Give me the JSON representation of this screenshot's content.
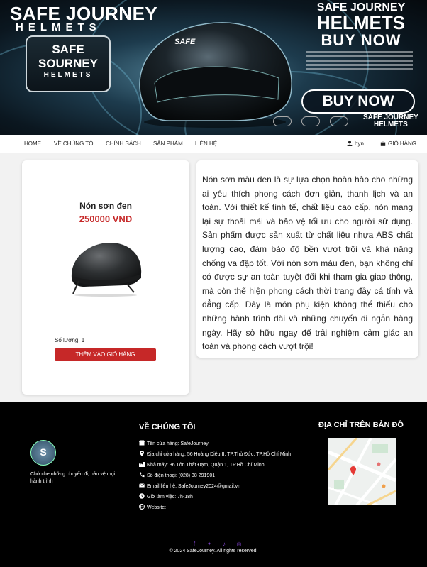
{
  "banner": {
    "brand_title": "SAFE JOURNEY",
    "brand_sub": "HELMETS",
    "shield_line1": "SAFE",
    "shield_line2": "SOURNEY",
    "shield_line3": "HELMETS",
    "right_line1": "SAFE JOURNEY",
    "right_line2": "HELMETS",
    "right_line3": "BUY NOW",
    "buy_now": "BUY NOW",
    "mini_brand_line1": "SAFE JOURNEY",
    "mini_brand_line2": "HELMETS",
    "helmet_logo": "SAFE"
  },
  "nav": {
    "items": [
      "HOME",
      "VỀ CHÚNG TÔI",
      "CHÍNH SÁCH",
      "SẢN PHẨM",
      "LIÊN HỆ"
    ],
    "user": "hyn",
    "cart": "GIỎ HÀNG"
  },
  "product": {
    "name": "Nón sơn đen",
    "price": "250000 VND",
    "quantity": "Số lượng: 1",
    "add_to_cart": "THÊM VÀO GIỎ HÀNG",
    "description": "Nón sơn màu đen là sự lựa chọn hoàn hảo cho những ai yêu thích phong cách đơn giản, thanh lịch và an toàn. Với thiết kế tinh tế, chất liệu cao cấp, nón mang lại sự thoải mái và bảo vệ tối ưu cho người sử dụng. Sản phẩm được sản xuất từ chất liệu nhựa ABS chất lượng cao, đảm bảo độ bền vượt trội và khả năng chống va đập tốt. Với nón sơn màu đen, bạn không chỉ có được sự an toàn tuyệt đối khi tham gia giao thông, mà còn thể hiện phong cách thời trang đầy cá tính và đẳng cấp. Đây là món phụ kiện không thể thiếu cho những hành trình dài và những chuyến đi ngắn hàng ngày. Hãy sở hữu ngay để trải nghiệm cảm giác an toàn và phong cách vượt trội!"
  },
  "footer": {
    "logo_text": "S",
    "tagline": "Chở che những chuyến đi, bảo vệ mọi hành trình",
    "about_heading": "VỀ CHÚNG TÔI",
    "map_heading": "ĐỊA CHỈ TRÊN BẢN ĐỒ",
    "rows": [
      {
        "icon": "store-icon",
        "text": "Tên cửa hàng: SafeJourney"
      },
      {
        "icon": "location-pin-icon",
        "text": "Địa chỉ cửa hàng: 56 Hoàng Diệu II, TP.Thủ Đức, TP.Hồ Chí Minh"
      },
      {
        "icon": "factory-icon",
        "text": "Nhà máy: 36 Tôn Thất Đạm, Quận 1, TP.Hồ Chí Minh"
      },
      {
        "icon": "phone-icon",
        "text": "Số điện thoại: (028) 38 291901"
      },
      {
        "icon": "envelope-icon",
        "text": "Email liên hệ: SafeJourney2024@gmail.vn"
      },
      {
        "icon": "clock-icon",
        "text": "Giờ làm việc: 7h-18h"
      },
      {
        "icon": "globe-icon",
        "text": "Website:"
      }
    ],
    "socials": [
      "facebook-icon",
      "twitter-icon",
      "tiktok-icon",
      "instagram-icon"
    ],
    "copyright": "© 2024 SafeJourney. All rights reserved."
  },
  "colors": {
    "accent_red": "#c62828",
    "footer_bg": "#000000",
    "social_purple": "#7b3fc4"
  }
}
